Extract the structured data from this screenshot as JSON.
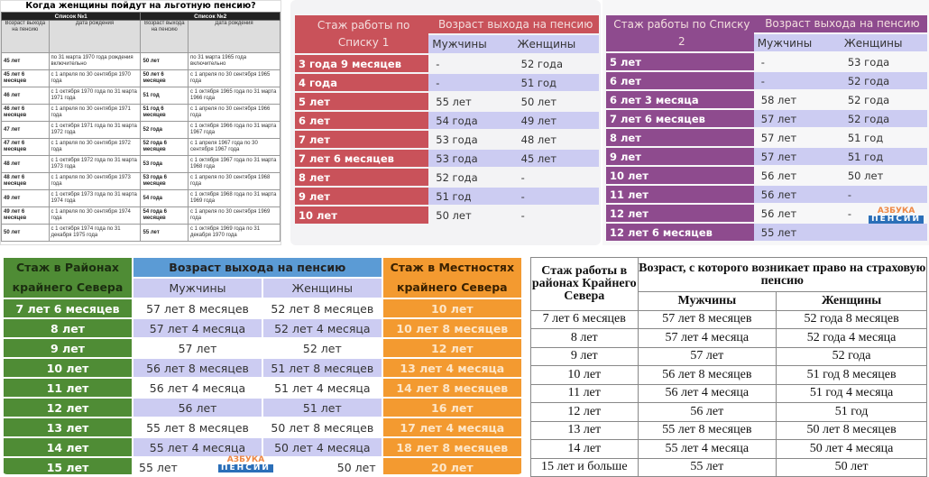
{
  "panel_a": {
    "title": "Когда женщины пойдут на льготную пенсию?",
    "list1": "Список №1",
    "list2": "Список №2",
    "col_age": "Возраст выхода на пенсию",
    "col_date": "Дата рождения",
    "rows": [
      [
        "45 лет",
        "по 31 марта 1970 года рождения включительно",
        "50 лет",
        "по 31 марта 1965 года включительно"
      ],
      [
        "45 лет 6 месяцев",
        "с 1 апреля по 30 сентября 1970 года",
        "50 лет 6 месяцев",
        "с 1 апреля по 30 сентября 1965 года"
      ],
      [
        "46 лет",
        "с 1 октября 1970 года по 31 марта 1971 года",
        "51 год",
        "с 1 октября 1965 года по 31 марта 1966 года"
      ],
      [
        "46 лет 6 месяцев",
        "с 1 апреля по 30 сентября 1971 года",
        "51 год 6 месяцев",
        "с 1 апреля по 30 сентября 1966 года"
      ],
      [
        "47 лет",
        "с 1 октября 1971 года по 31 марта 1972 года",
        "52 года",
        "с 1 октября 1966 года по 31 марта 1967 года"
      ],
      [
        "47 лет 6 месяцев",
        "с 1 апреля по 30 сентября 1972 года",
        "52 года 6 месяцев",
        "с 1 апреля 1967 года по 30 сентября 1967 года"
      ],
      [
        "48 лет",
        "с 1 октября 1972 года по 31 марта 1973 года",
        "53 года",
        "с 1 октября 1967 года по 31 марта 1968 года"
      ],
      [
        "48 лет 6 месяцев",
        "с 1 апреля по 30 сентября 1973 года",
        "53 года 6 месяцев",
        "с 1 апреля по 30 сентября 1968 года"
      ],
      [
        "49 лет",
        "с 1 октября 1973 года по 31 марта 1974 года",
        "54 года",
        "с 1 октября 1968 года по 31 марта 1969 года"
      ],
      [
        "49 лет 6 месяцев",
        "с 1 апреля по 30 сентября 1974 года",
        "54 года 6 месяцев",
        "с 1 апреля по 30 сентября 1969 года"
      ],
      [
        "50 лет",
        "с 1 октября 1974 года по 31 декабря 1975 года",
        "55 лет",
        "с 1 октября 1969 года по 31 декабря 1970 года"
      ]
    ]
  },
  "panel_b": {
    "color": "#c9525a",
    "col_stage": "Стаж работы по Списку 1",
    "col_age": "Возраст выхода на пенсию",
    "men": "Мужчины",
    "women": "Женщины",
    "rows": [
      [
        "3 года 9 месяцев",
        "-",
        "52 года"
      ],
      [
        "4 года",
        "-",
        "51 год"
      ],
      [
        "5 лет",
        "55 лет",
        "50 лет"
      ],
      [
        "6 лет",
        "54 года",
        "49 лет"
      ],
      [
        "7 лет",
        "53 года",
        "48 лет"
      ],
      [
        "7 лет 6 месяцев",
        "53 года",
        "45 лет"
      ],
      [
        "8 лет",
        "52 года",
        "-"
      ],
      [
        "9 лет",
        "51 год",
        "-"
      ],
      [
        "10 лет",
        "50 лет",
        "-"
      ]
    ]
  },
  "panel_c": {
    "color": "#8e4b8e",
    "col_stage": "Стаж работы по Списку 2",
    "col_age": "Возраст выхода на пенсию",
    "men": "Мужчины",
    "women": "Женщины",
    "rows": [
      [
        "5 лет",
        "-",
        "53 года"
      ],
      [
        "6 лет",
        "-",
        "52 года"
      ],
      [
        "6 лет 3 месяца",
        "58 лет",
        "52 года"
      ],
      [
        "7 лет 6 месяцев",
        "57 лет",
        "52 года"
      ],
      [
        "8 лет",
        "57 лет",
        "51 год"
      ],
      [
        "9 лет",
        "57 лет",
        "51 год"
      ],
      [
        "10 лет",
        "56 лет",
        "50 лет"
      ],
      [
        "11 лет",
        "56 лет",
        "-"
      ],
      [
        "12 лет",
        "56 лет",
        "-"
      ],
      [
        "12 лет 6 месяцев",
        "55 лет",
        ""
      ]
    ],
    "logo": {
      "top": "АЗБУКА",
      "bottom": "ПЕНСИИ"
    }
  },
  "panel_d": {
    "col_far_north": "Стаж в Районах крайнего Севера",
    "col_age": "Возраст выхода на пенсию",
    "men": "Мужчины",
    "women": "Женщины",
    "col_equiv": "Стаж в Местностях крайнего Севера",
    "rows": [
      [
        "7 лет 6 месяцев",
        "57 лет 8 месяцев",
        "52 лет 8 месяцев",
        "10 лет"
      ],
      [
        "8 лет",
        "57 лет 4 месяца",
        "52 лет 4 месяца",
        "10 лет 8 месяцев"
      ],
      [
        "9 лет",
        "57 лет",
        "52 лет",
        "12 лет"
      ],
      [
        "10 лет",
        "56 лет 8 месяцев",
        "51 лет 8 месяцев",
        "13 лет 4 месяца"
      ],
      [
        "11 лет",
        "56 лет 4 месяца",
        "51 лет 4 месяца",
        "14 лет 8 месяцев"
      ],
      [
        "12 лет",
        "56 лет",
        "51 лет",
        "16 лет"
      ],
      [
        "13 лет",
        "55 лет 8 месяцев",
        "50 лет 8 месяцев",
        "17 лет 4 месяца"
      ],
      [
        "14 лет",
        "55 лет 4 месяца",
        "50 лет 4 месяца",
        "18 лет 8 месяцев"
      ],
      [
        "15 лет",
        "55 лет",
        "50 лет",
        "20 лет"
      ]
    ],
    "logo": {
      "top": "АЗБУКА",
      "bottom": "ПЕНСИИ"
    }
  },
  "panel_e": {
    "col_stage": "Стаж работы в районах Крайнего Севера",
    "col_age": "Возраст, с которого возникает право на страховую пенсию",
    "men": "Мужчины",
    "women": "Женщины",
    "rows": [
      [
        "7 лет 6 месяцев",
        "57 лет 8 месяцев",
        "52 года 8 месяцев"
      ],
      [
        "8 лет",
        "57 лет 4 месяца",
        "52 года 4 месяца"
      ],
      [
        "9 лет",
        "57 лет",
        "52 года"
      ],
      [
        "10 лет",
        "56 лет 8 месяцев",
        "51 год 8 месяцев"
      ],
      [
        "11 лет",
        "56 лет 4 месяца",
        "51 год 4 месяца"
      ],
      [
        "12 лет",
        "56 лет",
        "51 год"
      ],
      [
        "13 лет",
        "55 лет 8 месяцев",
        "50 лет 8 месяцев"
      ],
      [
        "14 лет",
        "55 лет 4 месяца",
        "50 лет 4 месяца"
      ],
      [
        "15 лет и больше",
        "55 лет",
        "50 лет"
      ]
    ]
  }
}
